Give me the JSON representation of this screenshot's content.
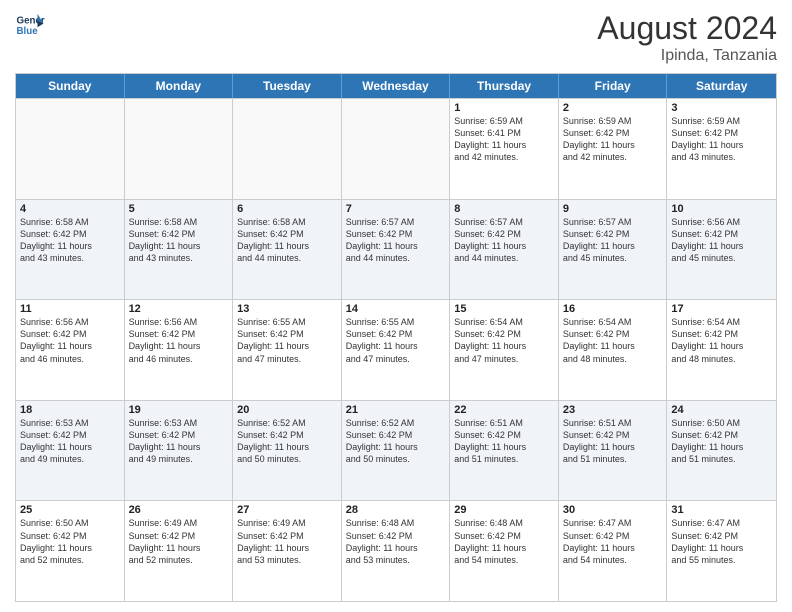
{
  "header": {
    "logo_line1": "General",
    "logo_line2": "Blue",
    "title": "August 2024",
    "location": "Ipinda, Tanzania"
  },
  "days_of_week": [
    "Sunday",
    "Monday",
    "Tuesday",
    "Wednesday",
    "Thursday",
    "Friday",
    "Saturday"
  ],
  "weeks": [
    [
      {
        "day": "",
        "info": ""
      },
      {
        "day": "",
        "info": ""
      },
      {
        "day": "",
        "info": ""
      },
      {
        "day": "",
        "info": ""
      },
      {
        "day": "1",
        "info": "Sunrise: 6:59 AM\nSunset: 6:41 PM\nDaylight: 11 hours\nand 42 minutes."
      },
      {
        "day": "2",
        "info": "Sunrise: 6:59 AM\nSunset: 6:42 PM\nDaylight: 11 hours\nand 42 minutes."
      },
      {
        "day": "3",
        "info": "Sunrise: 6:59 AM\nSunset: 6:42 PM\nDaylight: 11 hours\nand 43 minutes."
      }
    ],
    [
      {
        "day": "4",
        "info": "Sunrise: 6:58 AM\nSunset: 6:42 PM\nDaylight: 11 hours\nand 43 minutes."
      },
      {
        "day": "5",
        "info": "Sunrise: 6:58 AM\nSunset: 6:42 PM\nDaylight: 11 hours\nand 43 minutes."
      },
      {
        "day": "6",
        "info": "Sunrise: 6:58 AM\nSunset: 6:42 PM\nDaylight: 11 hours\nand 44 minutes."
      },
      {
        "day": "7",
        "info": "Sunrise: 6:57 AM\nSunset: 6:42 PM\nDaylight: 11 hours\nand 44 minutes."
      },
      {
        "day": "8",
        "info": "Sunrise: 6:57 AM\nSunset: 6:42 PM\nDaylight: 11 hours\nand 44 minutes."
      },
      {
        "day": "9",
        "info": "Sunrise: 6:57 AM\nSunset: 6:42 PM\nDaylight: 11 hours\nand 45 minutes."
      },
      {
        "day": "10",
        "info": "Sunrise: 6:56 AM\nSunset: 6:42 PM\nDaylight: 11 hours\nand 45 minutes."
      }
    ],
    [
      {
        "day": "11",
        "info": "Sunrise: 6:56 AM\nSunset: 6:42 PM\nDaylight: 11 hours\nand 46 minutes."
      },
      {
        "day": "12",
        "info": "Sunrise: 6:56 AM\nSunset: 6:42 PM\nDaylight: 11 hours\nand 46 minutes."
      },
      {
        "day": "13",
        "info": "Sunrise: 6:55 AM\nSunset: 6:42 PM\nDaylight: 11 hours\nand 47 minutes."
      },
      {
        "day": "14",
        "info": "Sunrise: 6:55 AM\nSunset: 6:42 PM\nDaylight: 11 hours\nand 47 minutes."
      },
      {
        "day": "15",
        "info": "Sunrise: 6:54 AM\nSunset: 6:42 PM\nDaylight: 11 hours\nand 47 minutes."
      },
      {
        "day": "16",
        "info": "Sunrise: 6:54 AM\nSunset: 6:42 PM\nDaylight: 11 hours\nand 48 minutes."
      },
      {
        "day": "17",
        "info": "Sunrise: 6:54 AM\nSunset: 6:42 PM\nDaylight: 11 hours\nand 48 minutes."
      }
    ],
    [
      {
        "day": "18",
        "info": "Sunrise: 6:53 AM\nSunset: 6:42 PM\nDaylight: 11 hours\nand 49 minutes."
      },
      {
        "day": "19",
        "info": "Sunrise: 6:53 AM\nSunset: 6:42 PM\nDaylight: 11 hours\nand 49 minutes."
      },
      {
        "day": "20",
        "info": "Sunrise: 6:52 AM\nSunset: 6:42 PM\nDaylight: 11 hours\nand 50 minutes."
      },
      {
        "day": "21",
        "info": "Sunrise: 6:52 AM\nSunset: 6:42 PM\nDaylight: 11 hours\nand 50 minutes."
      },
      {
        "day": "22",
        "info": "Sunrise: 6:51 AM\nSunset: 6:42 PM\nDaylight: 11 hours\nand 51 minutes."
      },
      {
        "day": "23",
        "info": "Sunrise: 6:51 AM\nSunset: 6:42 PM\nDaylight: 11 hours\nand 51 minutes."
      },
      {
        "day": "24",
        "info": "Sunrise: 6:50 AM\nSunset: 6:42 PM\nDaylight: 11 hours\nand 51 minutes."
      }
    ],
    [
      {
        "day": "25",
        "info": "Sunrise: 6:50 AM\nSunset: 6:42 PM\nDaylight: 11 hours\nand 52 minutes."
      },
      {
        "day": "26",
        "info": "Sunrise: 6:49 AM\nSunset: 6:42 PM\nDaylight: 11 hours\nand 52 minutes."
      },
      {
        "day": "27",
        "info": "Sunrise: 6:49 AM\nSunset: 6:42 PM\nDaylight: 11 hours\nand 53 minutes."
      },
      {
        "day": "28",
        "info": "Sunrise: 6:48 AM\nSunset: 6:42 PM\nDaylight: 11 hours\nand 53 minutes."
      },
      {
        "day": "29",
        "info": "Sunrise: 6:48 AM\nSunset: 6:42 PM\nDaylight: 11 hours\nand 54 minutes."
      },
      {
        "day": "30",
        "info": "Sunrise: 6:47 AM\nSunset: 6:42 PM\nDaylight: 11 hours\nand 54 minutes."
      },
      {
        "day": "31",
        "info": "Sunrise: 6:47 AM\nSunset: 6:42 PM\nDaylight: 11 hours\nand 55 minutes."
      }
    ]
  ]
}
